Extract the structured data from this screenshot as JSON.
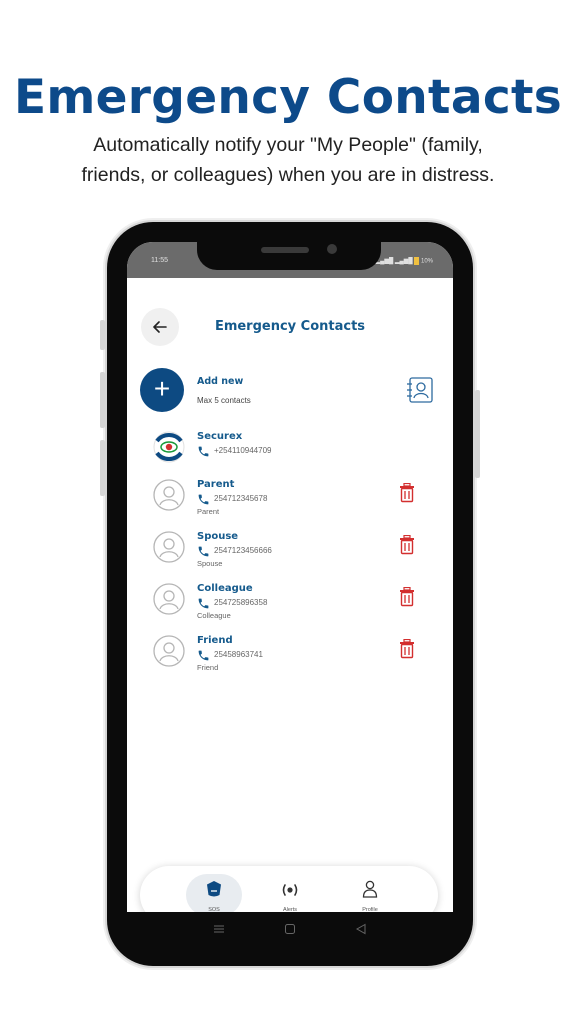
{
  "hero": {
    "title": "Emergency Contacts",
    "subtitle": "Automatically notify your \"My People\" (family, friends, or colleagues) when you are in distress."
  },
  "status_bar": {
    "time": "11:55",
    "battery": "10%"
  },
  "header": {
    "title": "Emergency Contacts",
    "back_icon": "arrow-left-icon"
  },
  "add_new": {
    "label": "Add new",
    "hint": "Max 5 contacts",
    "icon": "plus-icon",
    "contacts_icon": "contact-book-icon"
  },
  "contacts": [
    {
      "name": "Securex",
      "phone": "+254110944709",
      "relation": "",
      "deletable": false
    },
    {
      "name": "Parent",
      "phone": "254712345678",
      "relation": "Parent",
      "deletable": true
    },
    {
      "name": "Spouse",
      "phone": "2547123456666",
      "relation": "Spouse",
      "deletable": true
    },
    {
      "name": "Colleague",
      "phone": "254725896358",
      "relation": "Colleague",
      "deletable": true
    },
    {
      "name": "Friend",
      "phone": "25458963741",
      "relation": "Friend",
      "deletable": true
    }
  ],
  "bottom_nav": {
    "items": [
      {
        "label": "SOS",
        "icon": "shield-icon",
        "active": true
      },
      {
        "label": "Alerts",
        "icon": "broadcast-icon",
        "active": false
      },
      {
        "label": "Profile",
        "icon": "person-icon",
        "active": false
      }
    ]
  },
  "colors": {
    "brand": "#0d4a8a",
    "accent": "#155a8c",
    "delete": "#d32f2f"
  }
}
